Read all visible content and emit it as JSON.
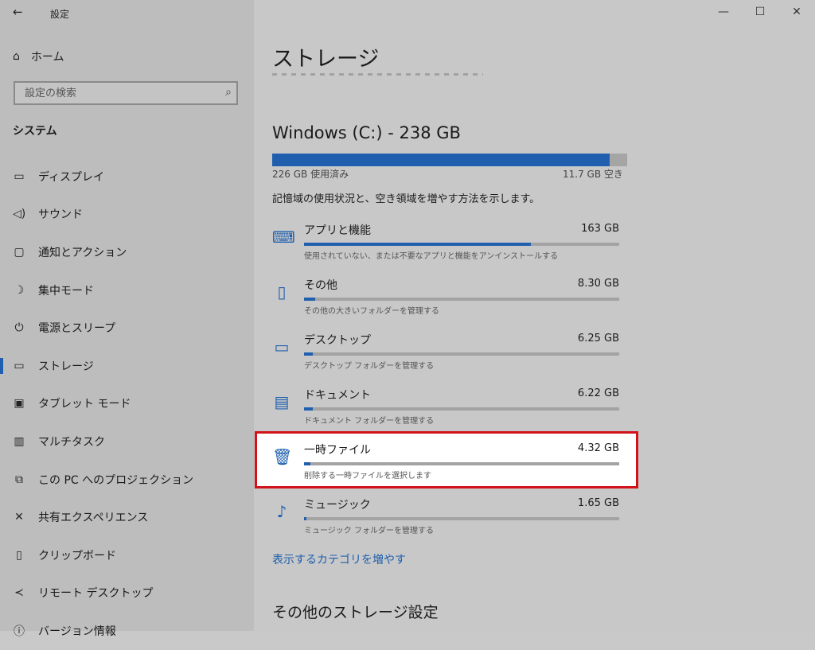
{
  "window": {
    "title": "設定",
    "back_icon": "back-arrow-icon"
  },
  "sidebar": {
    "home_label": "ホーム",
    "search_placeholder": "設定の検索",
    "section_title": "システム",
    "items": [
      {
        "label": "ディスプレイ",
        "icon": "display-icon"
      },
      {
        "label": "サウンド",
        "icon": "speaker-icon"
      },
      {
        "label": "通知とアクション",
        "icon": "notification-icon"
      },
      {
        "label": "集中モード",
        "icon": "moon-icon"
      },
      {
        "label": "電源とスリープ",
        "icon": "power-icon"
      },
      {
        "label": "ストレージ",
        "icon": "storage-icon",
        "active": true
      },
      {
        "label": "タブレット モード",
        "icon": "tablet-icon"
      },
      {
        "label": "マルチタスク",
        "icon": "multitask-icon"
      },
      {
        "label": "この PC へのプロジェクション",
        "icon": "projection-icon"
      },
      {
        "label": "共有エクスペリエンス",
        "icon": "shared-icon"
      },
      {
        "label": "クリップボード",
        "icon": "clipboard-icon"
      },
      {
        "label": "リモート デスクトップ",
        "icon": "remote-icon"
      },
      {
        "label": "バージョン情報",
        "icon": "info-icon"
      }
    ]
  },
  "main": {
    "page_title": "ストレージ",
    "drive": {
      "title": "Windows (C:) - 238 GB",
      "used_label": "226 GB 使用済み",
      "free_label": "11.7 GB 空き",
      "used_fraction": 0.951
    },
    "description": "記憶域の使用状況と、空き領域を増やす方法を示します。",
    "categories": [
      {
        "name": "アプリと機能",
        "size": "163 GB",
        "sub": "使用されていない、または不要なアプリと機能をアンインストールする",
        "fraction": 0.72,
        "icon": "keyboard-icon",
        "glyph": "⌨"
      },
      {
        "name": "その他",
        "size": "8.30 GB",
        "sub": "その他の大きいフォルダーを管理する",
        "fraction": 0.035,
        "icon": "other-icon",
        "glyph": "▯"
      },
      {
        "name": "デスクトップ",
        "size": "6.25 GB",
        "sub": "デスクトップ フォルダーを管理する",
        "fraction": 0.027,
        "icon": "desktop-icon",
        "glyph": "▭"
      },
      {
        "name": "ドキュメント",
        "size": "6.22 GB",
        "sub": "ドキュメント フォルダーを管理する",
        "fraction": 0.027,
        "icon": "documents-icon",
        "glyph": "▤"
      },
      {
        "name": "一時ファイル",
        "size": "4.32 GB",
        "sub": "削除する一時ファイルを選択します",
        "fraction": 0.019,
        "icon": "trash-icon",
        "glyph": "🗑"
      },
      {
        "name": "ミュージック",
        "size": "1.65 GB",
        "sub": "ミュージック フォルダーを管理する",
        "fraction": 0.008,
        "icon": "music-icon",
        "glyph": "♪"
      }
    ],
    "more_categories_link": "表示するカテゴリを増やす",
    "more_settings_title": "その他のストレージ設定"
  },
  "colors": {
    "accent": "#1f5fae",
    "highlight_border": "#d2121a"
  }
}
